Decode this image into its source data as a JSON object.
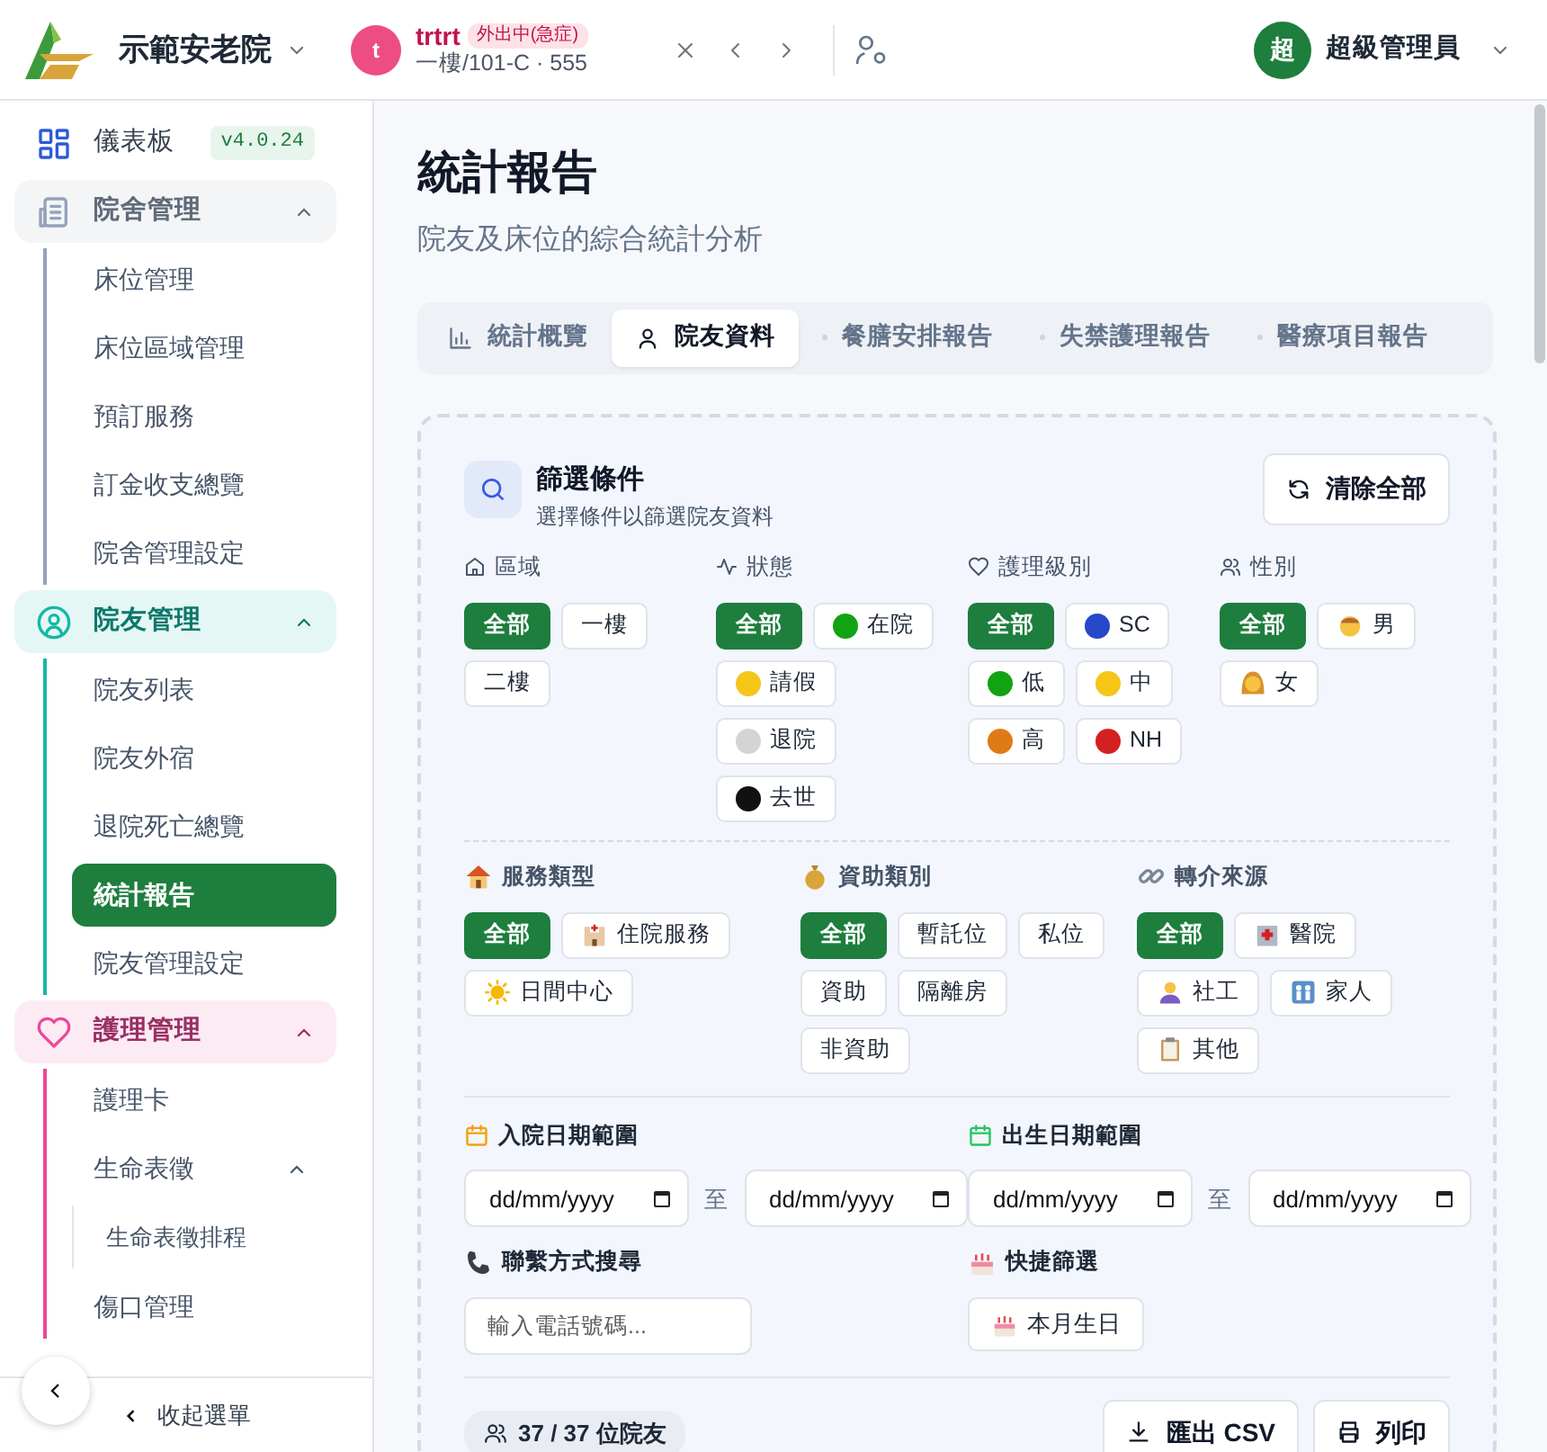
{
  "header": {
    "org": "示範安老院",
    "resident": {
      "avatar": "t",
      "name": "trtrt",
      "badge": "外出中(急症)",
      "location": "一樓/101-C · 555"
    },
    "user": {
      "avatar": "超",
      "name": "超級管理員"
    }
  },
  "sidebar": {
    "items": [
      {
        "label": "儀表板",
        "kind": "link",
        "badge": "v4.0.24"
      },
      {
        "label": "院舍管理",
        "kind": "group",
        "expanded": true,
        "color": "#94a3b8",
        "children": [
          {
            "label": "床位管理",
            "selected": false
          },
          {
            "label": "床位區域管理",
            "selected": false
          },
          {
            "label": "預訂服務",
            "selected": false
          },
          {
            "label": "訂金收支總覽",
            "selected": false
          },
          {
            "label": "院舍管理設定",
            "selected": false
          }
        ]
      },
      {
        "label": "院友管理",
        "kind": "group",
        "expanded": true,
        "color": "#14b8a6",
        "children": [
          {
            "label": "院友列表",
            "selected": false
          },
          {
            "label": "院友外宿",
            "selected": false
          },
          {
            "label": "退院死亡總覽",
            "selected": false
          },
          {
            "label": "統計報告",
            "selected": true
          },
          {
            "label": "院友管理設定",
            "selected": false
          }
        ]
      },
      {
        "label": "護理管理",
        "kind": "group",
        "expanded": true,
        "color": "#ec4899",
        "children": [
          {
            "label": "護理卡",
            "selected": false
          },
          {
            "label": "生命表徵",
            "selected": false,
            "expanded": true,
            "children": [
              {
                "label": "生命表徵排程",
                "selected": false
              }
            ]
          },
          {
            "label": "傷口管理",
            "selected": false
          }
        ]
      }
    ],
    "collapse": "收起選單"
  },
  "page": {
    "title": "統計報告",
    "subtitle": "院友及床位的綜合統計分析"
  },
  "tabs": [
    {
      "label": "統計概覽",
      "selected": false
    },
    {
      "label": "院友資料",
      "selected": true
    },
    {
      "label": "餐膳安排報告",
      "selected": false
    },
    {
      "label": "失禁護理報告",
      "selected": false
    },
    {
      "label": "醫療項目報告",
      "selected": false
    }
  ],
  "filters": {
    "title": "篩選條件",
    "subtitle": "選擇條件以篩選院友資料",
    "clear": "清除全部",
    "primary_filters": [
      {
        "label": "區域",
        "options": [
          {
            "label": "全部",
            "selected": true
          },
          {
            "label": "一樓",
            "selected": false
          },
          {
            "label": "二樓",
            "selected": false
          }
        ]
      },
      {
        "label": "狀態",
        "options": [
          {
            "label": "全部",
            "selected": true
          },
          {
            "label": "在院",
            "selected": false,
            "color": "#12a312"
          },
          {
            "label": "請假",
            "selected": false,
            "color": "#f5c518"
          },
          {
            "label": "退院",
            "selected": false,
            "color": "#d4d4d4"
          },
          {
            "label": "去世",
            "selected": false,
            "color": "#111111"
          }
        ]
      },
      {
        "label": "護理級別",
        "options": [
          {
            "label": "全部",
            "selected": true
          },
          {
            "label": "SC",
            "selected": false,
            "color": "#2748c9"
          },
          {
            "label": "低",
            "selected": false,
            "color": "#12a312"
          },
          {
            "label": "中",
            "selected": false,
            "color": "#f5c518"
          },
          {
            "label": "高",
            "selected": false,
            "color": "#e07a16"
          },
          {
            "label": "NH",
            "selected": false,
            "color": "#d42020"
          }
        ]
      },
      {
        "label": "性別",
        "options": [
          {
            "label": "全部",
            "selected": true
          },
          {
            "label": "男",
            "selected": false
          },
          {
            "label": "女",
            "selected": false
          }
        ]
      }
    ],
    "secondary_filters": [
      {
        "label": "服務類型",
        "options": [
          {
            "label": "全部",
            "selected": true
          },
          {
            "label": "住院服務",
            "selected": false
          },
          {
            "label": "日間中心",
            "selected": false
          }
        ]
      },
      {
        "label": "資助類別",
        "options": [
          {
            "label": "全部",
            "selected": true
          },
          {
            "label": "暫託位",
            "selected": false
          },
          {
            "label": "私位",
            "selected": false
          },
          {
            "label": "資助",
            "selected": false
          },
          {
            "label": "隔離房",
            "selected": false
          },
          {
            "label": "非資助",
            "selected": false
          }
        ]
      },
      {
        "label": "轉介來源",
        "options": [
          {
            "label": "全部",
            "selected": true
          },
          {
            "label": "醫院",
            "selected": false
          },
          {
            "label": "社工",
            "selected": false
          },
          {
            "label": "家人",
            "selected": false
          },
          {
            "label": "其他",
            "selected": false
          }
        ]
      }
    ],
    "dates": [
      {
        "label": "入院日期範圍",
        "color": "#f59e0b",
        "from": "dd/mm/yyyy",
        "separator": "至",
        "to": "dd/mm/yyyy"
      },
      {
        "label": "出生日期範圍",
        "color": "#22c55e",
        "from": "dd/mm/yyyy",
        "separator": "至",
        "to": "dd/mm/yyyy"
      }
    ],
    "contact": {
      "label": "聯繫方式搜尋",
      "placeholder": "輸入電話號碼..."
    },
    "quick": {
      "label": "快捷篩選",
      "button": "本月生日"
    }
  },
  "results": {
    "count": "37 / 37 位院友",
    "export": "匯出 CSV",
    "print": "列印"
  }
}
